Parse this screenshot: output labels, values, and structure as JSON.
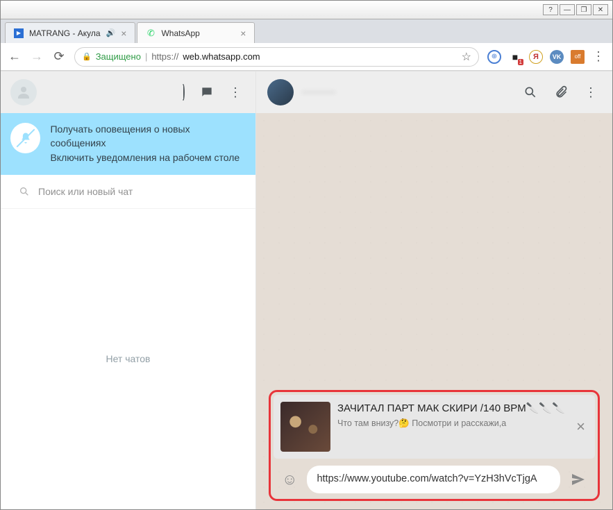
{
  "window_controls": {
    "min": "—",
    "max": "❐",
    "close": "✕"
  },
  "tabs": [
    {
      "title": "MATRANG - Акула",
      "active": false,
      "audio": true
    },
    {
      "title": "WhatsApp",
      "active": true,
      "audio": false
    }
  ],
  "addressbar": {
    "secure_label": "Защищено",
    "url_scheme": "https://",
    "url_host": "web.whatsapp.com"
  },
  "browser_ext_colors": {
    "globe": "#4a7fd4",
    "red": "#d23c3c",
    "yandex": "#ffd24d",
    "vk": "#5b8bc0",
    "off": "#d97b2e"
  },
  "sidebar": {
    "notif": {
      "title": "Получать оповещения о новых сообщениях",
      "subtitle": "Включить уведомления на рабочем столе"
    },
    "search_placeholder": "Поиск или новый чат",
    "empty_label": "Нет чатов"
  },
  "chat": {
    "contact_name": "———",
    "preview": {
      "title": "ЗАЧИТАЛ ПАРТ МАК СКИРИ /140 BPM🔪🔪🔪",
      "desc": "Что там внизу?🤔 Посмотри и расскажи,а"
    },
    "input_value": "https://www.youtube.com/watch?v=YzH3hVcTjgA"
  }
}
